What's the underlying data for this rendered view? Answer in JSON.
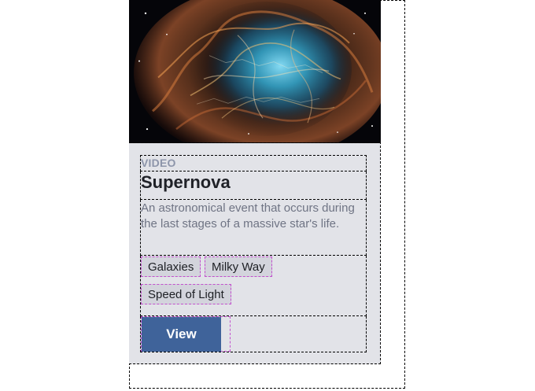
{
  "card": {
    "category": "VIDEO",
    "title": "Supernova",
    "description": "An astronomical event that occurs during the last stages of a massive star's life.",
    "tags": [
      "Galaxies",
      "Milky Way",
      "Speed of Light"
    ],
    "button_label": "View",
    "colors": {
      "card_background": "#e2e3e8",
      "button": "#3f639a",
      "category_text": "#8d95aa",
      "tag_background": "#d3d4dc"
    }
  }
}
